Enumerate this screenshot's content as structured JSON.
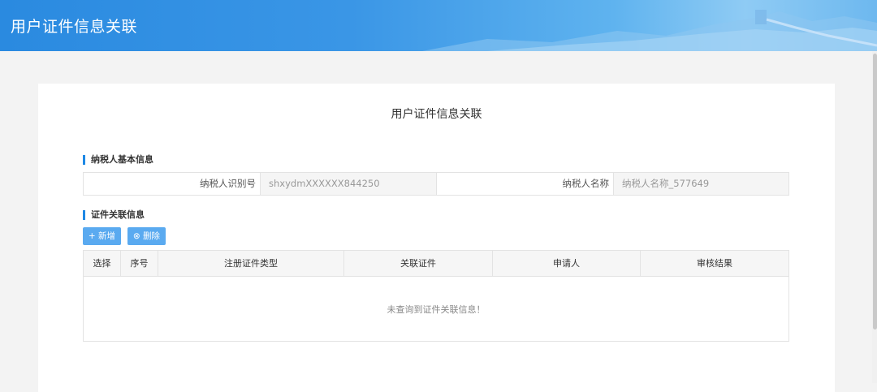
{
  "header": {
    "title": "用户证件信息关联"
  },
  "card": {
    "title": "用户证件信息关联"
  },
  "basic_section": {
    "title": "纳税人基本信息",
    "taxpayer_id_label": "纳税人识别号",
    "taxpayer_id_value": "shxydmXXXXXX844250",
    "taxpayer_name_label": "纳税人名称",
    "taxpayer_name_value": "纳税人名称_577649"
  },
  "cert_section": {
    "title": "证件关联信息",
    "add_label": "+ 新增",
    "delete_label": "⊗ 删除",
    "columns": [
      "选择",
      "序号",
      "注册证件类型",
      "关联证件",
      "申请人",
      "审核结果"
    ],
    "empty_message": "未查询到证件关联信息！"
  }
}
